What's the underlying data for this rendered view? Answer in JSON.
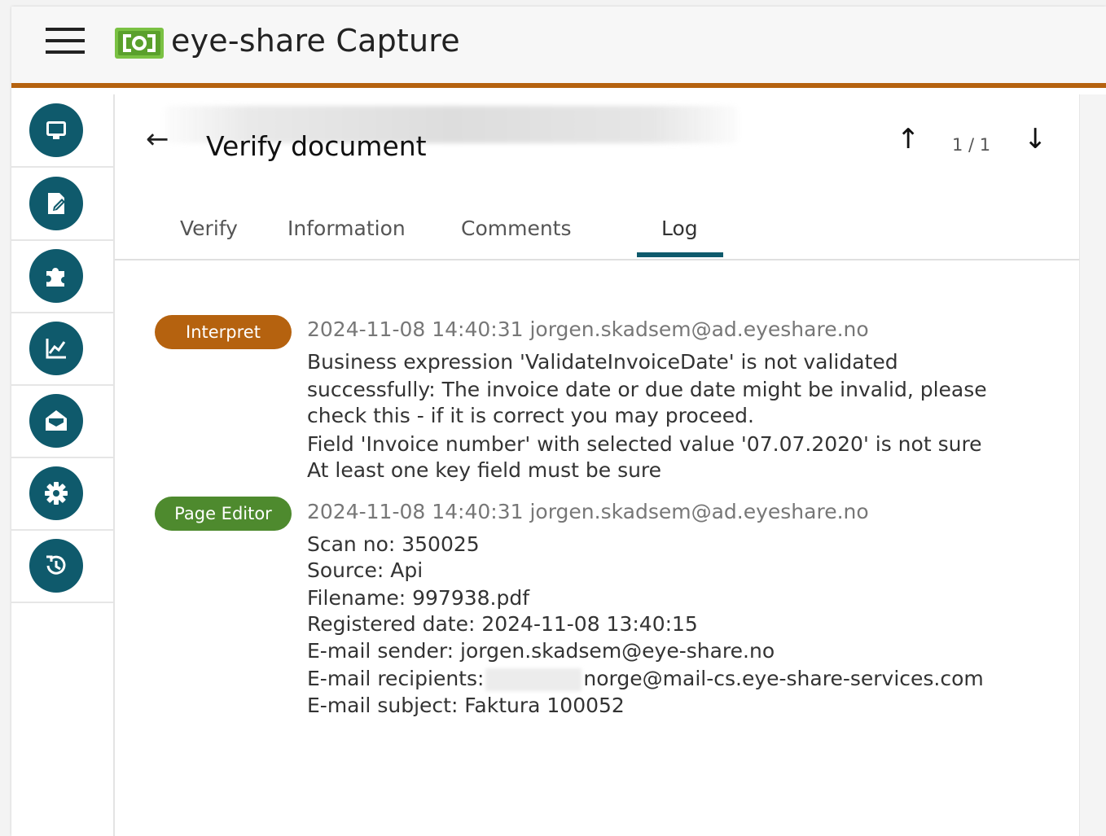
{
  "app": {
    "title": "eye-share Capture",
    "accent_color": "#b5620f",
    "nav_color": "#0f5a6c"
  },
  "sidebar": {
    "items": [
      {
        "icon": "monitor-icon"
      },
      {
        "icon": "edit-document-icon"
      },
      {
        "icon": "puzzle-icon"
      },
      {
        "icon": "chart-icon"
      },
      {
        "icon": "mail-open-icon"
      },
      {
        "icon": "gear-icon"
      },
      {
        "icon": "history-icon"
      }
    ]
  },
  "header": {
    "title": "Verify document",
    "pager": "1 / 1"
  },
  "tabs": [
    {
      "label": "Verify"
    },
    {
      "label": "Information"
    },
    {
      "label": "Comments"
    },
    {
      "label": "Log",
      "active": true
    }
  ],
  "log": [
    {
      "badge": "Interpret",
      "badge_color": "#b5620f",
      "meta": "2024-11-08 14:40:31 jorgen.skadsem@ad.eyeshare.no",
      "lines": [
        "Business expression 'ValidateInvoiceDate' is not validated",
        "successfully: The invoice date or due date might be invalid, please",
        "check this - if it is correct you may proceed.",
        "Field 'Invoice number' with selected value '07.07.2020' is not sure",
        "At least one key field must be sure"
      ]
    },
    {
      "badge": "Page Editor",
      "badge_color": "#4e8a2e",
      "meta": "2024-11-08 14:40:31 jorgen.skadsem@ad.eyeshare.no",
      "lines": [
        "Scan no: 350025",
        "Source: Api",
        "Filename: 997938.pdf",
        "Registered date: 2024-11-08 13:40:15",
        "E-mail sender: jorgen.skadsem@eye-share.no"
      ],
      "recipients_label": "E-mail recipients:",
      "recipients_value": "norge@mail-cs.eye-share-services.com",
      "subject_line": "E-mail subject: Faktura 100052"
    }
  ]
}
